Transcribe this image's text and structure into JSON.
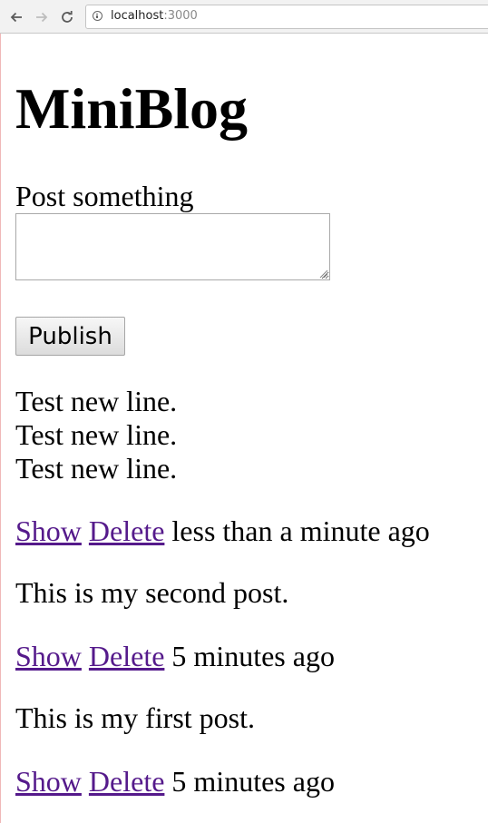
{
  "browser": {
    "url_host": "localhost",
    "url_port": ":3000"
  },
  "page": {
    "title": "MiniBlog",
    "post_label": "Post something",
    "textarea_value": "",
    "publish_label": "Publish"
  },
  "posts": [
    {
      "lines": [
        "Test new line.",
        "Test new line.",
        "Test new line."
      ],
      "show_label": "Show",
      "delete_label": "Delete",
      "time": "less than a minute ago"
    },
    {
      "lines": [
        "This is my second post."
      ],
      "show_label": "Show",
      "delete_label": "Delete",
      "time": "5 minutes ago"
    },
    {
      "lines": [
        "This is my first post."
      ],
      "show_label": "Show",
      "delete_label": "Delete",
      "time": "5 minutes ago"
    }
  ],
  "colors": {
    "visited_link": "#551a8b"
  }
}
